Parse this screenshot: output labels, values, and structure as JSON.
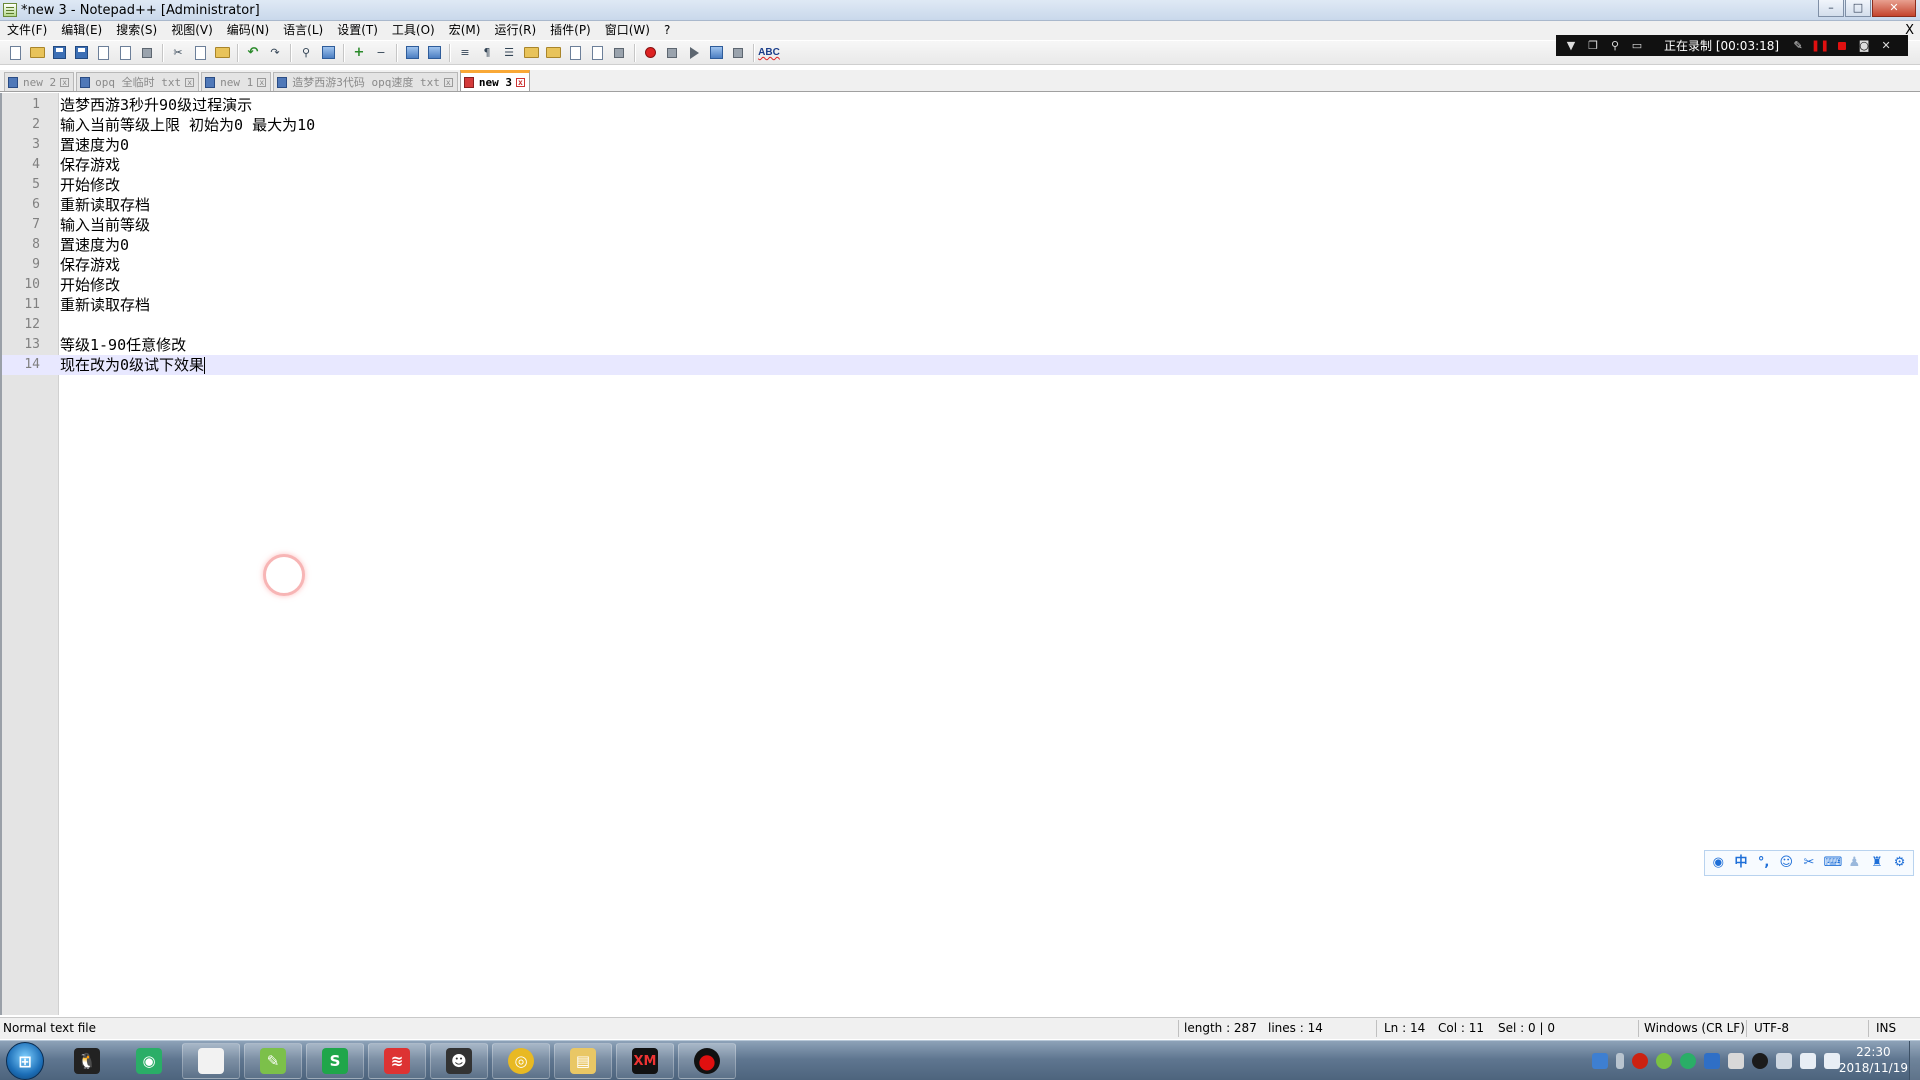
{
  "window": {
    "title": "*new 3 - Notepad++ [Administrator]",
    "buttons": {
      "minimize": "–",
      "maximize": "□",
      "close": "✕"
    }
  },
  "menu": {
    "items": [
      "文件(F)",
      "编辑(E)",
      "搜索(S)",
      "视图(V)",
      "编码(N)",
      "语言(L)",
      "设置(T)",
      "工具(O)",
      "宏(M)",
      "运行(R)",
      "插件(P)",
      "窗口(W)",
      "?"
    ],
    "close": "X"
  },
  "toolbar": {
    "spellcheck_label": "ABC"
  },
  "recorder": {
    "status": "正在录制 [00:03:18]"
  },
  "tabs": [
    {
      "label": "new 2",
      "active": false
    },
    {
      "label": "opq 全临时 txt",
      "active": false
    },
    {
      "label": "new 1",
      "active": false
    },
    {
      "label": "造梦西游3代码 opq速度 txt",
      "active": false
    },
    {
      "label": "new 3",
      "active": true
    }
  ],
  "tab_close_glyph": "x",
  "editor": {
    "lines": [
      {
        "n": "1",
        "text": "造梦西游3秒升90级过程演示"
      },
      {
        "n": "2",
        "text": "输入当前等级上限 初始为0 最大为10"
      },
      {
        "n": "3",
        "text": "置速度为0"
      },
      {
        "n": "4",
        "text": "保存游戏"
      },
      {
        "n": "5",
        "text": "开始修改"
      },
      {
        "n": "6",
        "text": "重新读取存档"
      },
      {
        "n": "7",
        "text": "输入当前等级"
      },
      {
        "n": "8",
        "text": "置速度为0"
      },
      {
        "n": "9",
        "text": "保存游戏"
      },
      {
        "n": "10",
        "text": "开始修改"
      },
      {
        "n": "11",
        "text": "重新读取存档"
      },
      {
        "n": "12",
        "text": ""
      },
      {
        "n": "13",
        "text": "等级1-90任意修改"
      },
      {
        "n": "14",
        "text": "现在改为0级试下效果"
      }
    ],
    "current_line": 14
  },
  "ime": {
    "mode": "中"
  },
  "status": {
    "file_type": "Normal text file",
    "length": "length : 287",
    "lines": "lines : 14",
    "ln": "Ln : 14",
    "col": "Col : 11",
    "sel": "Sel : 0 | 0",
    "eol": "Windows (CR LF)",
    "encoding": "UTF-8",
    "mode": "INS"
  },
  "taskbar": {
    "apps": [
      {
        "name": "qq",
        "color": "#1b1b1b",
        "glyph": "🐧"
      },
      {
        "name": "wechat",
        "color": "#2aae67",
        "glyph": "◉"
      },
      {
        "name": "blank-doc",
        "color": "#f2f2f2",
        "glyph": ""
      },
      {
        "name": "notepad-plus-plus",
        "color": "#7cc04a",
        "glyph": "✎"
      },
      {
        "name": "wps",
        "color": "#1fa64a",
        "glyph": "S"
      },
      {
        "name": "baidu-netdisk",
        "color": "#d33",
        "glyph": "≋"
      },
      {
        "name": "game-avatar",
        "color": "#333",
        "glyph": "☻"
      },
      {
        "name": "chrome",
        "color": "#e8b923",
        "glyph": "◎"
      },
      {
        "name": "file-explorer",
        "color": "#e9c765",
        "glyph": "▤"
      },
      {
        "name": "xm-app",
        "color": "#111",
        "glyph": "XM"
      },
      {
        "name": "screen-recorder",
        "color": "#111",
        "glyph": "●"
      }
    ],
    "time": "22:30",
    "date": "2018/11/19"
  },
  "colors": {
    "current_line": "#e8e8ff",
    "active_tab_accent": "#f9a836",
    "recorder_bg": "#111111"
  }
}
